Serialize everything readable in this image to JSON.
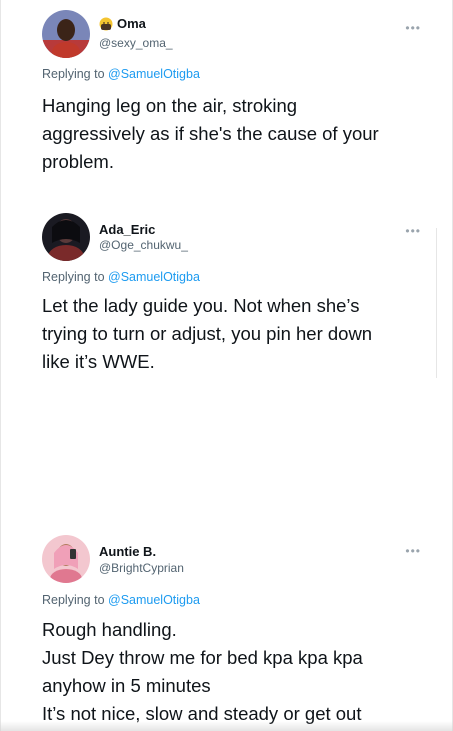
{
  "tweets": [
    {
      "display_name": "Oma",
      "name_emoji": "hugging-face-emoji",
      "handle": "@sexy_oma_",
      "replying_prefix": "Replying to ",
      "replying_mention": "@SamuelOtigba",
      "text_lines": [
        "Hanging leg on the air, stroking",
        "aggressively as if she's the cause of your",
        "problem."
      ],
      "more_icon": "more-options-icon",
      "more_glyph": "•••"
    },
    {
      "display_name": "Ada_Eric",
      "handle": "@Oge_chukwu_",
      "replying_prefix": "Replying to ",
      "replying_mention": "@SamuelOtigba",
      "text_lines": [
        "Let the lady guide you. Not when she’s",
        "trying to turn or adjust, you pin her down",
        "like it’s WWE."
      ],
      "more_icon": "more-options-icon",
      "more_glyph": "•••"
    },
    {
      "display_name": "Auntie B.",
      "handle": "@BrightCyprian",
      "replying_prefix": "Replying to ",
      "replying_mention": "@SamuelOtigba",
      "text_lines": [
        "Rough handling.",
        "Just Dey throw me for bed kpa kpa kpa",
        "anyhow in 5 minutes",
        "It’s not nice, slow and steady or get out"
      ],
      "more_icon": "more-options-icon",
      "more_glyph": "•••"
    }
  ],
  "colors": {
    "text": "#0f1419",
    "secondary": "#536471",
    "mention": "#1d9bf0",
    "divider": "#e6e6e6"
  }
}
